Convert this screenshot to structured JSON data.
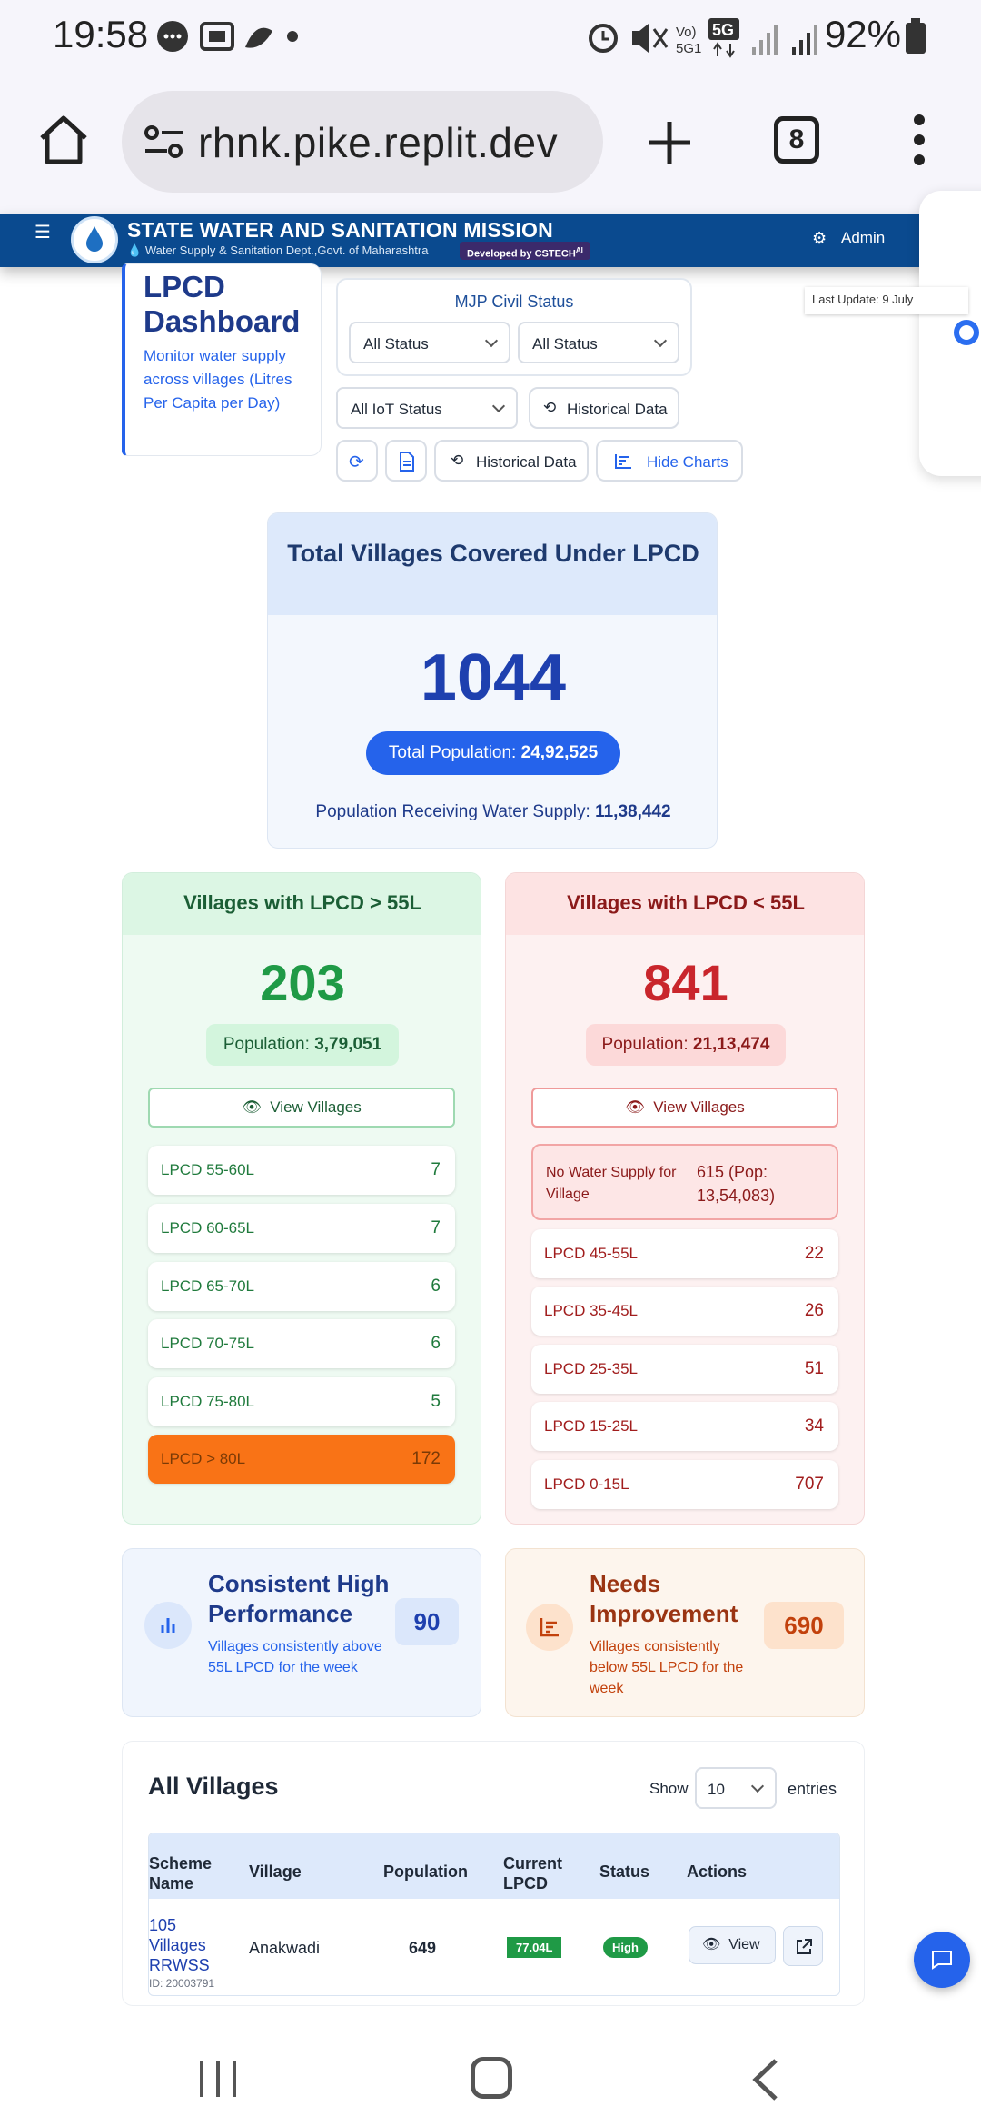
{
  "status_bar": {
    "time": "19:58",
    "battery_pct": "92%"
  },
  "browser": {
    "url": "rhnk.pike.replit.dev",
    "tab_count": "8"
  },
  "header": {
    "title": "STATE WATER AND SANITATION MISSION",
    "subtitle": "Water Supply & Sanitation Dept.,Govt. of Maharashtra",
    "developed_by": "Developed by CSTECH",
    "developed_by_sup": "AI",
    "admin_label": "Admin"
  },
  "dashboard": {
    "title": "LPCD Dashboard",
    "description": "Monitor water supply across villages (Litres Per Capita per Day)",
    "last_update": "Last Update: 9 July"
  },
  "filters": {
    "mjp_title": "MJP Civil Status",
    "status_select_1": "All Status",
    "status_select_2": "All Status",
    "iot_select": "All IoT Status",
    "historical_data_1": "Historical Data",
    "historical_data_2": "Historical Data",
    "hide_charts": "Hide Charts"
  },
  "total_card": {
    "title": "Total Villages Covered Under LPCD",
    "count": "1044",
    "population_label": "Total Population:",
    "population_value": "24,92,525",
    "receiving_label": "Population Receiving Water Supply:",
    "receiving_value": "11,38,442"
  },
  "above_card": {
    "title": "Villages with LPCD > 55L",
    "count": "203",
    "population_label": "Population:",
    "population_value": "3,79,051",
    "view_label": "View Villages",
    "ranges": [
      {
        "label": "LPCD 55-60L",
        "value": "7"
      },
      {
        "label": "LPCD 60-65L",
        "value": "7"
      },
      {
        "label": "LPCD 65-70L",
        "value": "6"
      },
      {
        "label": "LPCD 70-75L",
        "value": "6"
      },
      {
        "label": "LPCD 75-80L",
        "value": "5"
      },
      {
        "label": "LPCD > 80L",
        "value": "172"
      }
    ]
  },
  "below_card": {
    "title": "Villages with LPCD < 55L",
    "count": "841",
    "population_label": "Population:",
    "population_value": "21,13,474",
    "view_label": "View Villages",
    "no_supply_label": "No Water Supply for Village",
    "no_supply_value": "615 (Pop: 13,54,083)",
    "ranges": [
      {
        "label": "LPCD 45-55L",
        "value": "22"
      },
      {
        "label": "LPCD 35-45L",
        "value": "26"
      },
      {
        "label": "LPCD 25-35L",
        "value": "51"
      },
      {
        "label": "LPCD 15-25L",
        "value": "34"
      },
      {
        "label": "LPCD 0-15L",
        "value": "707"
      }
    ]
  },
  "high_perf": {
    "title": "Consistent High Performance",
    "description": "Villages consistently above 55L LPCD for the week",
    "count": "90"
  },
  "needs_improvement": {
    "title": "Needs Improvement",
    "description": "Villages consistently below 55L LPCD for the week",
    "count": "690"
  },
  "table": {
    "title": "All Villages",
    "show_label": "Show",
    "entries_value": "10",
    "entries_label": "entries",
    "columns": [
      "Scheme Name",
      "Village",
      "Population",
      "Current LPCD",
      "Status",
      "Actions"
    ],
    "rows": [
      {
        "scheme": "105 Villages RRWSS",
        "scheme_id": "ID: 20003791",
        "village": "Anakwadi",
        "population": "649",
        "lpcd": "77.04L",
        "status": "High",
        "view": "View"
      }
    ]
  },
  "colors": {
    "header_blue": "#0a4a8f",
    "green": "#1f9a46",
    "red": "#c9262c",
    "orange": "#f97316",
    "primary": "#2563eb"
  }
}
